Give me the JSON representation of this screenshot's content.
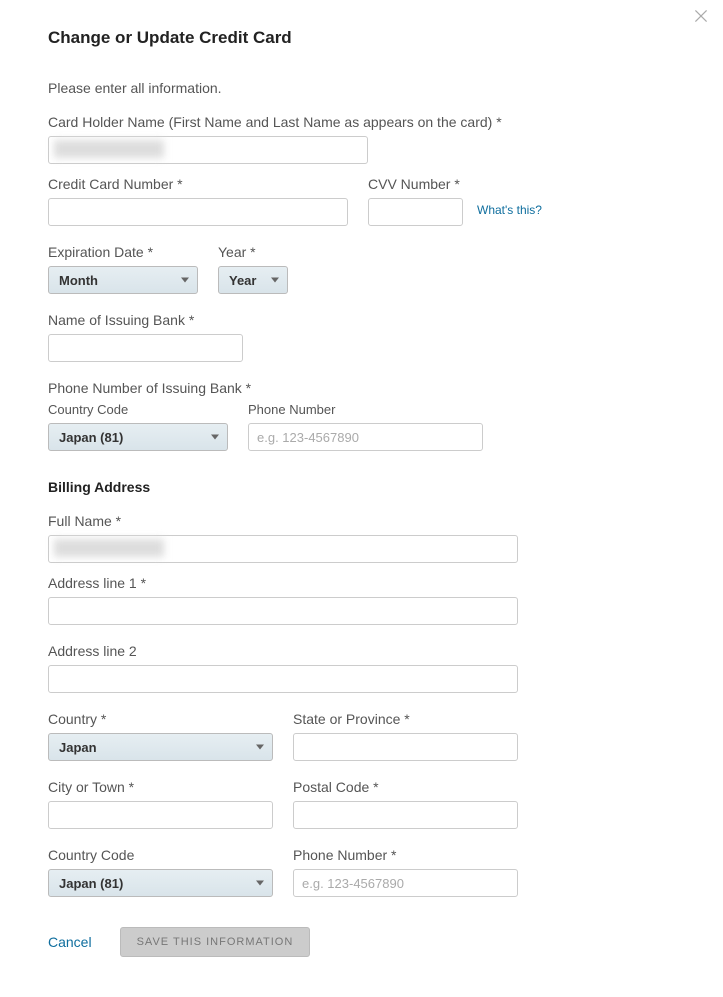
{
  "title": "Change or Update Credit Card",
  "intro": "Please enter all information.",
  "card": {
    "holder_label": "Card Holder Name (First Name and Last Name as appears on the card) *",
    "holder_value": "Redacted Name",
    "number_label": "Credit Card Number *",
    "cvv_label": "CVV Number *",
    "whats_this": "What's this?",
    "exp_label": "Expiration Date *",
    "month_select": "Month",
    "year_label": "Year *",
    "year_select": "Year",
    "bank_label": "Name of Issuing Bank *",
    "bank_phone_label": "Phone Number of Issuing Bank *",
    "cc_label": "Country Code",
    "cc_select": "Japan (81)",
    "phone_label": "Phone Number",
    "phone_placeholder": "e.g. 123-4567890"
  },
  "billing": {
    "heading": "Billing Address",
    "fullname_label": "Full Name *",
    "fullname_value": "Redacted Name",
    "addr1_label": "Address line 1 *",
    "addr2_label": "Address line 2",
    "country_label": "Country *",
    "country_select": "Japan",
    "state_label": "State or Province *",
    "city_label": "City or Town *",
    "postal_label": "Postal Code *",
    "cc_label": "Country Code",
    "cc_select": "Japan (81)",
    "phone_label": "Phone Number *",
    "phone_placeholder": "e.g. 123-4567890"
  },
  "footer": {
    "cancel": "Cancel",
    "save": "SAVE THIS INFORMATION"
  }
}
